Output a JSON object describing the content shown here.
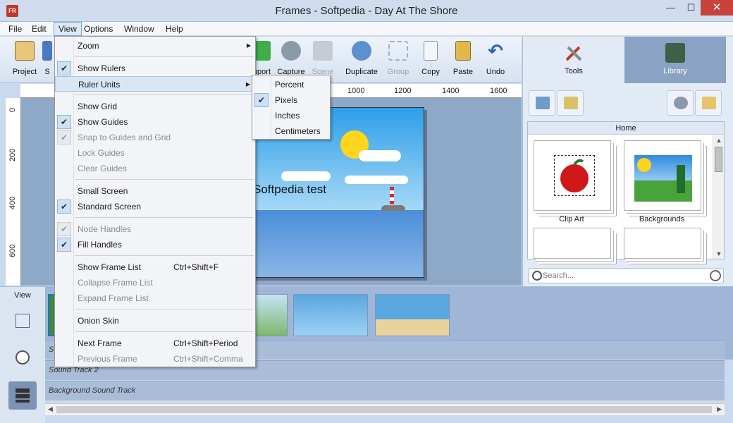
{
  "window": {
    "title": "Frames - Softpedia - Day At The Shore",
    "app_icon_text": "FR",
    "minimize": "—",
    "maximize": "☐",
    "close": "✕"
  },
  "menubar": {
    "items": [
      "File",
      "Edit",
      "View",
      "Options",
      "Window",
      "Help"
    ]
  },
  "toolbar": {
    "items": [
      {
        "label": "Project",
        "icon": "project-icon",
        "enabled": true
      },
      {
        "label": "S",
        "icon": "save-icon",
        "enabled": true
      },
      {
        "label": "nport",
        "icon": "import-icon",
        "enabled": true
      },
      {
        "label": "Capture",
        "icon": "capture-icon",
        "enabled": true
      },
      {
        "label": "Scene",
        "icon": "scene-icon",
        "enabled": false
      },
      {
        "label": "Duplicate",
        "icon": "duplicate-icon",
        "enabled": true
      },
      {
        "label": "Group",
        "icon": "group-icon",
        "enabled": false
      },
      {
        "label": "Copy",
        "icon": "copy-icon",
        "enabled": true
      },
      {
        "label": "Paste",
        "icon": "paste-icon",
        "enabled": true
      },
      {
        "label": "Undo",
        "icon": "undo-icon",
        "enabled": true
      }
    ]
  },
  "right_panel": {
    "tabs": [
      {
        "label": "Tools",
        "icon": "tools-icon",
        "active": false
      },
      {
        "label": "Library",
        "icon": "library-icon",
        "active": true
      }
    ],
    "library": {
      "header": "Home",
      "items": [
        {
          "label": "Clip Art",
          "icon": "clip-art-apple-icon"
        },
        {
          "label": "Backgrounds",
          "icon": "backgrounds-icon"
        }
      ]
    },
    "search": {
      "placeholder": "Search..."
    }
  },
  "rulers": {
    "horizontal": [
      "1000",
      "1200",
      "1400",
      "1600"
    ],
    "vertical": [
      "0",
      "200",
      "400",
      "600"
    ]
  },
  "slide": {
    "text": "Softpedia test"
  },
  "bottom": {
    "view_label": "View",
    "tracks": [
      "So",
      "Sound Track 2",
      "Background Sound Track"
    ]
  },
  "view_menu": {
    "items": [
      {
        "label": "Zoom",
        "submenu": true
      },
      {
        "type": "separator"
      },
      {
        "label": "Show Rulers",
        "checked": true
      },
      {
        "label": "Ruler Units",
        "submenu": true,
        "hover": true
      },
      {
        "type": "separator"
      },
      {
        "label": "Show Grid"
      },
      {
        "label": "Show Guides",
        "checked": true
      },
      {
        "label": "Snap to Guides and Grid",
        "checked": true,
        "disabled": true
      },
      {
        "label": "Lock Guides",
        "disabled": true
      },
      {
        "label": "Clear Guides",
        "disabled": true
      },
      {
        "type": "separator"
      },
      {
        "label": "Small Screen"
      },
      {
        "label": "Standard Screen",
        "checked": true
      },
      {
        "type": "separator"
      },
      {
        "label": "Node Handles",
        "checked": true,
        "disabled": true
      },
      {
        "label": "Fill Handles",
        "checked": true
      },
      {
        "type": "separator"
      },
      {
        "label": "Show Frame List",
        "shortcut": "Ctrl+Shift+F"
      },
      {
        "label": "Collapse Frame List",
        "disabled": true
      },
      {
        "label": "Expand Frame List",
        "disabled": true
      },
      {
        "type": "separator"
      },
      {
        "label": "Onion Skin"
      },
      {
        "type": "separator"
      },
      {
        "label": "Next Frame",
        "shortcut": "Ctrl+Shift+Period"
      },
      {
        "label": "Previous Frame",
        "shortcut": "Ctrl+Shift+Comma",
        "disabled": true
      }
    ]
  },
  "ruler_units_menu": {
    "items": [
      {
        "label": "Percent"
      },
      {
        "label": "Pixels",
        "checked": true
      },
      {
        "label": "Inches"
      },
      {
        "label": "Centimeters"
      }
    ]
  },
  "colors": {
    "accent": "#7aa2d6",
    "panel": "#8ea8c8",
    "active_tab": "#8aa3c5"
  }
}
